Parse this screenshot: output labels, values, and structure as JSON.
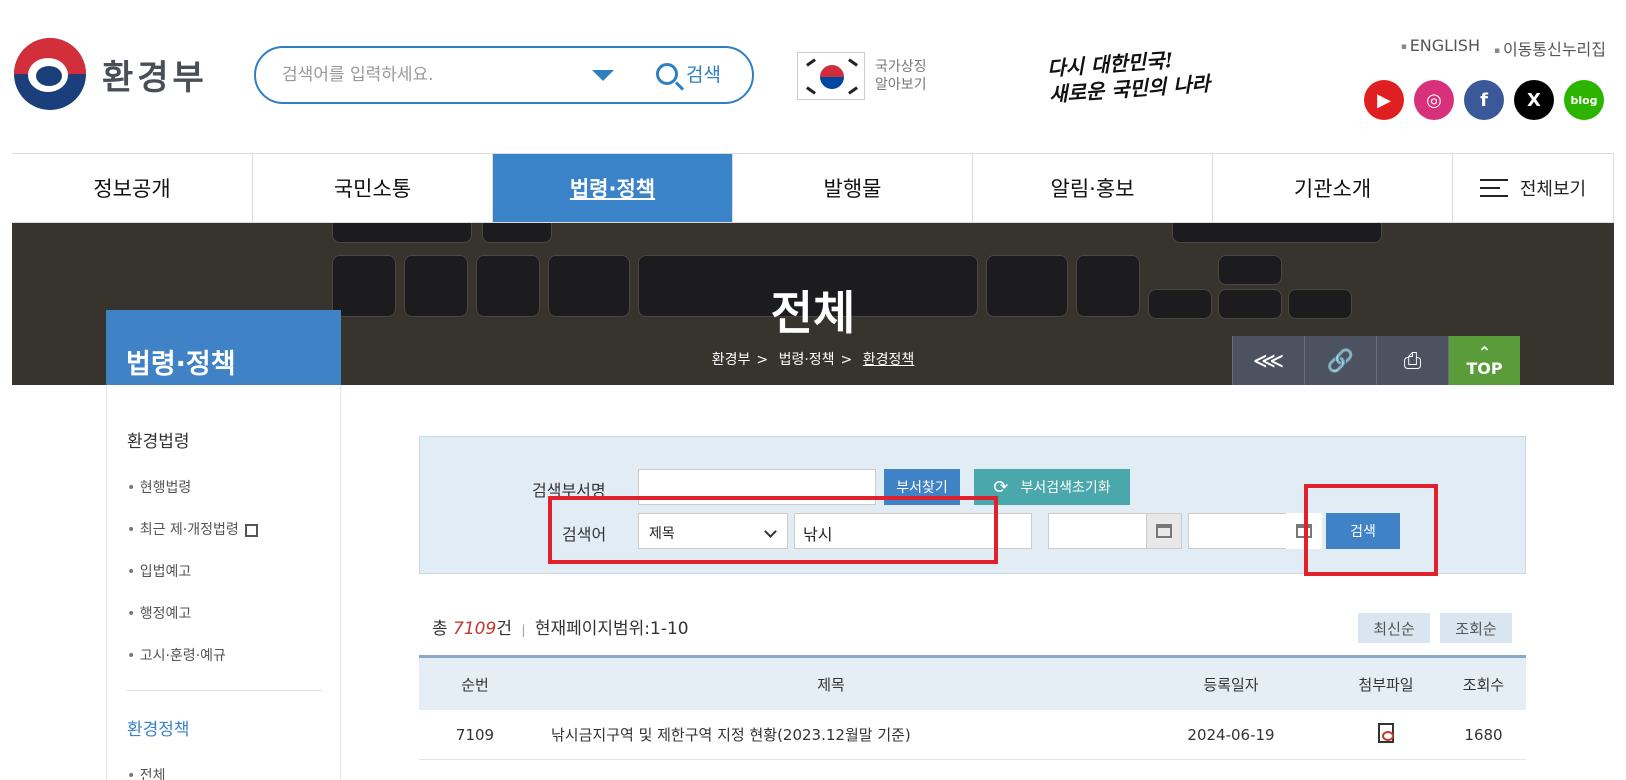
{
  "header": {
    "logo_text": "환경부",
    "search_placeholder": "검색어를 입력하세요.",
    "search_button": "검색",
    "symbol_line1": "국가상징",
    "symbol_line2": "알아보기",
    "slogan_line1": "다시 대한민국!",
    "slogan_line2": "새로운 국민의 나라",
    "links": [
      "ENGLISH",
      "이동통신누리집"
    ],
    "sns": [
      {
        "name": "youtube-icon",
        "color": "#e02020",
        "glyph": "▶"
      },
      {
        "name": "instagram-icon",
        "color": "#d9307c",
        "glyph": "◎"
      },
      {
        "name": "facebook-icon",
        "color": "#3b5998",
        "glyph": "f"
      },
      {
        "name": "x-icon",
        "color": "#000000",
        "glyph": "X"
      },
      {
        "name": "blog-icon",
        "color": "#2db400",
        "glyph": "blog"
      }
    ]
  },
  "nav": {
    "items": [
      "정보공개",
      "국민소통",
      "법령·정책",
      "발행물",
      "알림·홍보",
      "기관소개"
    ],
    "active_index": 2,
    "all_label": "전체보기"
  },
  "banner": {
    "title": "전체",
    "breadcrumb": [
      "환경부",
      "법령·정책",
      "환경정책"
    ],
    "top_label": "TOP"
  },
  "sidebar": {
    "title": "법령·정책",
    "category1": "환경법령",
    "items1": [
      "현행법령",
      "최근 제·개정법령",
      "입법예고",
      "행정예고",
      "고시·훈령·예규"
    ],
    "category2": "환경정책",
    "items2": [
      "전체"
    ]
  },
  "search_panel": {
    "dept_label": "검색부서명",
    "dept_value": "",
    "find_dept_button": "부서찾기",
    "reset_dept_button": "부서검색초기화",
    "keyword_label": "검색어",
    "field_select": "제목",
    "keyword_value": "낚시",
    "date_from": "",
    "date_to": "",
    "search_button": "검색"
  },
  "results": {
    "total_prefix": "총",
    "total_count": "7109",
    "total_suffix": "건",
    "range_text": "현재페이지범위:1-10",
    "sort_latest": "최신순",
    "sort_views": "조회순",
    "columns": [
      "순번",
      "제목",
      "등록일자",
      "첨부파일",
      "조회수"
    ],
    "rows": [
      {
        "no": "7109",
        "title": "낚시금지구역 및 제한구역 지정 현황(2023.12월말 기준)",
        "date": "2024-06-19",
        "views": "1680"
      }
    ]
  }
}
